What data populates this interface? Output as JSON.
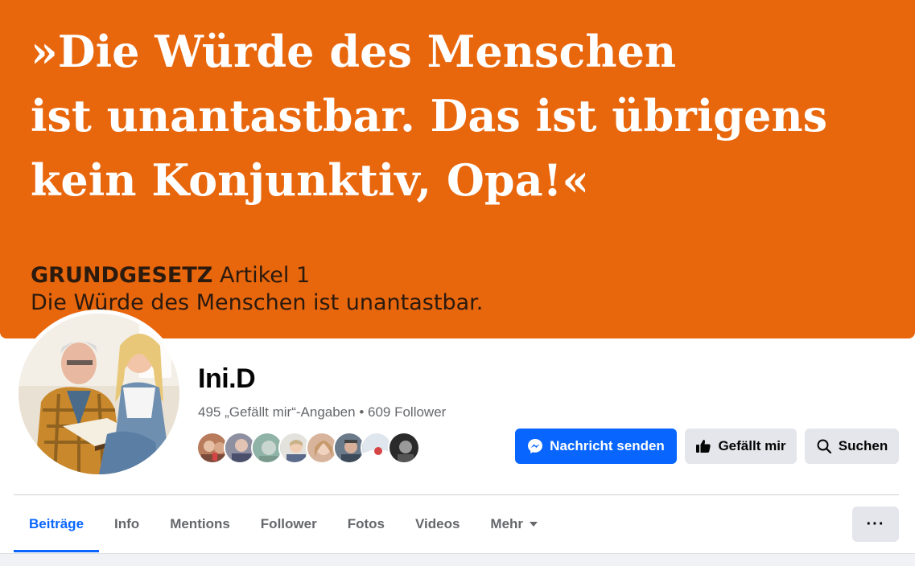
{
  "cover": {
    "quote_line1": "»Die Würde des Menschen",
    "quote_line2": "ist unantastbar. Das ist übrigens",
    "quote_line3": "kein Konjunktiv, Opa!«",
    "law_title": "GRUNDGESETZ",
    "law_article": " Artikel 1",
    "law_text": "Die Würde des Menschen ist unantastbar.",
    "background_color": "#e8660c"
  },
  "profile": {
    "name": "Ini.D",
    "stats": "495 „Gefällt mir“-Angaben • 609 Follower",
    "avatar_icon": "profile-photo-grandfather-and-child-reading"
  },
  "friends_count_shown": 8,
  "actions": {
    "message_label": "Nachricht senden",
    "like_label": "Gefällt mir",
    "search_label": "Suchen",
    "more_label": "···",
    "accent_color": "#0866ff"
  },
  "tabs": [
    {
      "label": "Beiträge",
      "active": true
    },
    {
      "label": "Info",
      "active": false
    },
    {
      "label": "Mentions",
      "active": false
    },
    {
      "label": "Follower",
      "active": false
    },
    {
      "label": "Fotos",
      "active": false
    },
    {
      "label": "Videos",
      "active": false
    },
    {
      "label": "Mehr",
      "active": false
    }
  ]
}
